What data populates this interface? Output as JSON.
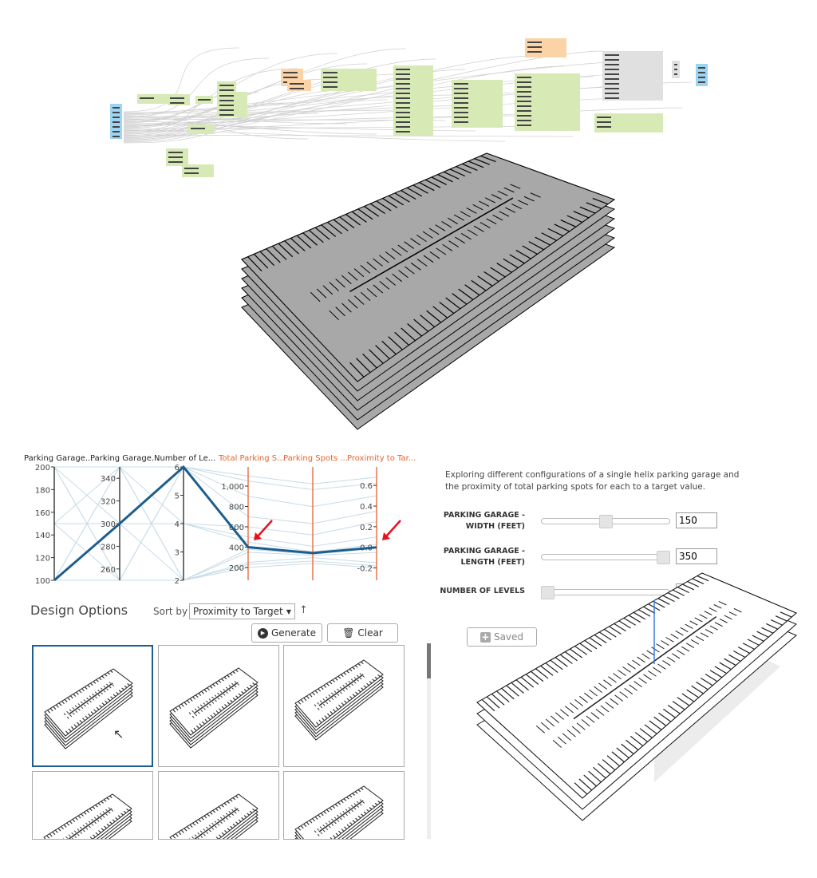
{
  "parallel_coordinates": {
    "axes": [
      {
        "label": "Parking Garage...",
        "range": [
          100,
          200
        ],
        "ticks": [
          100,
          120,
          140,
          160,
          180,
          200
        ],
        "color": "#000000"
      },
      {
        "label": "Parking Garage...",
        "range": [
          250,
          350
        ],
        "ticks": [
          260,
          280,
          300,
          320,
          340
        ],
        "color": "#000000"
      },
      {
        "label": "Number of Le...",
        "range": [
          2,
          6
        ],
        "ticks": [
          2,
          3,
          4,
          5,
          6
        ],
        "color": "#000000"
      },
      {
        "label": "Total Parking S...",
        "range": [
          75,
          1188
        ],
        "ticks": [
          200,
          400,
          600,
          800,
          1000
        ],
        "tick_labels": [
          "200",
          "400",
          "600",
          "800",
          "1,000"
        ],
        "color": "#e8622c"
      },
      {
        "label": "Parking Spots ...",
        "range": [
          0,
          1
        ],
        "ticks": [],
        "color": "#e8622c"
      },
      {
        "label": "Proximity to Tar...",
        "range": [
          -0.32,
          0.78
        ],
        "ticks": [
          -0.2,
          0.0,
          0.2,
          0.4,
          0.6
        ],
        "tick_labels": [
          "-0.2",
          "0.0",
          "0.2",
          "0.4",
          "0.6"
        ],
        "color": "#e8622c"
      }
    ],
    "highlight_color": "#1d5e8e",
    "highlight": [
      100,
      300,
      6,
      400,
      0.24,
      0.0
    ],
    "background_lines": [
      [
        200,
        250,
        2,
        250,
        0.2,
        -0.15
      ],
      [
        150,
        300,
        4,
        450,
        0.25,
        0.03
      ],
      [
        100,
        350,
        4,
        500,
        0.3,
        0.1
      ],
      [
        200,
        350,
        2,
        350,
        0.22,
        -0.05
      ],
      [
        150,
        250,
        6,
        700,
        0.5,
        0.35
      ],
      [
        100,
        250,
        2,
        200,
        0.15,
        -0.2
      ],
      [
        200,
        300,
        4,
        600,
        0.4,
        0.25
      ],
      [
        150,
        350,
        2,
        380,
        0.23,
        -0.01
      ],
      [
        100,
        300,
        2,
        230,
        0.17,
        -0.18
      ],
      [
        200,
        250,
        6,
        1050,
        0.8,
        0.62
      ],
      [
        150,
        300,
        6,
        1100,
        0.85,
        0.68
      ],
      [
        100,
        350,
        6,
        900,
        0.65,
        0.5
      ]
    ],
    "annotation_color": "#e8101a"
  },
  "design_options": {
    "title": "Design Options",
    "sort_label": "Sort by",
    "sort_value": "Proximity to Target",
    "sort_direction_icon": "arrow-up",
    "generate_label": "Generate",
    "clear_label": "Clear"
  },
  "panel": {
    "description": "Exploring different configurations of a single helix parking garage and the proximity of total parking spots for each to a target value.",
    "sliders": [
      {
        "label": "PARKING GARAGE - WIDTH (FEET)",
        "value": "150",
        "fraction": 0.5
      },
      {
        "label": "PARKING GARAGE - LENGTH (FEET)",
        "value": "350",
        "fraction": 1.0
      },
      {
        "label": "NUMBER OF LEVELS",
        "value": "2",
        "fraction": 0.0
      }
    ],
    "saved_label": "Saved"
  },
  "colors": {
    "node_green": "#d7e9b4",
    "node_orange": "#fbd3a6",
    "node_blue": "#9dd4f2",
    "node_gray": "#e0e0e0",
    "slab_gray": "#a8a8a8"
  }
}
